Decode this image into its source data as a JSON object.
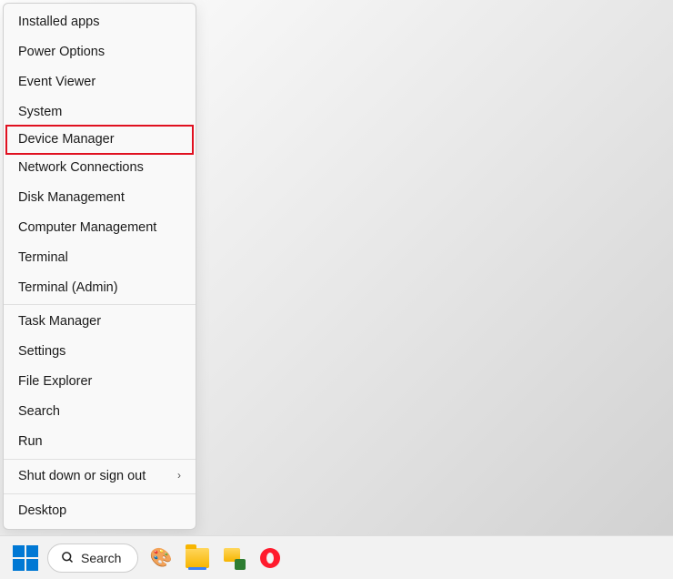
{
  "context_menu": {
    "groups": [
      [
        {
          "label": "Installed apps",
          "highlighted": false
        },
        {
          "label": "Power Options",
          "highlighted": false
        },
        {
          "label": "Event Viewer",
          "highlighted": false
        },
        {
          "label": "System",
          "highlighted": false
        },
        {
          "label": "Device Manager",
          "highlighted": true
        },
        {
          "label": "Network Connections",
          "highlighted": false
        },
        {
          "label": "Disk Management",
          "highlighted": false
        },
        {
          "label": "Computer Management",
          "highlighted": false
        },
        {
          "label": "Terminal",
          "highlighted": false
        },
        {
          "label": "Terminal (Admin)",
          "highlighted": false
        }
      ],
      [
        {
          "label": "Task Manager",
          "highlighted": false
        },
        {
          "label": "Settings",
          "highlighted": false
        },
        {
          "label": "File Explorer",
          "highlighted": false
        },
        {
          "label": "Search",
          "highlighted": false
        },
        {
          "label": "Run",
          "highlighted": false
        }
      ],
      [
        {
          "label": "Shut down or sign out",
          "highlighted": false,
          "submenu": true
        }
      ],
      [
        {
          "label": "Desktop",
          "highlighted": false
        }
      ]
    ]
  },
  "taskbar": {
    "search_label": "Search",
    "items": [
      {
        "name": "paint",
        "semantic": "paint-icon"
      },
      {
        "name": "file-explorer",
        "semantic": "file-explorer-icon"
      },
      {
        "name": "network-explorer",
        "semantic": "network-explorer-icon"
      },
      {
        "name": "opera",
        "semantic": "opera-icon"
      }
    ]
  }
}
